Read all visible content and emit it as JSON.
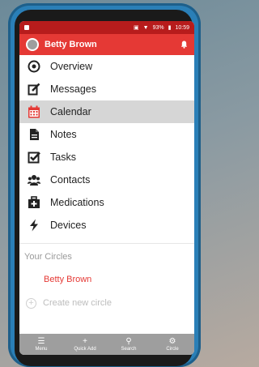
{
  "status_bar": {
    "battery": "93%",
    "time": "10:59"
  },
  "header": {
    "user_name": "Betty Brown"
  },
  "menu": [
    {
      "label": "Overview",
      "icon": "overview-icon"
    },
    {
      "label": "Messages",
      "icon": "messages-icon"
    },
    {
      "label": "Calendar",
      "icon": "calendar-icon",
      "active": true
    },
    {
      "label": "Notes",
      "icon": "notes-icon"
    },
    {
      "label": "Tasks",
      "icon": "tasks-icon"
    },
    {
      "label": "Contacts",
      "icon": "contacts-icon"
    },
    {
      "label": "Medications",
      "icon": "medications-icon"
    },
    {
      "label": "Devices",
      "icon": "devices-icon"
    }
  ],
  "circles": {
    "heading": "Your Circles",
    "items": [
      "Betty Brown"
    ],
    "create_label": "Create new circle"
  },
  "bottom_nav": [
    {
      "label": "Menu",
      "icon": "menu-icon"
    },
    {
      "label": "Quick Add",
      "icon": "plus-icon"
    },
    {
      "label": "Search",
      "icon": "search-icon"
    },
    {
      "label": "Circle",
      "icon": "gear-icon"
    }
  ],
  "colors": {
    "accent": "#e53935",
    "active_row": "#d6d6d6",
    "bottom_nav": "#9e9e9e"
  }
}
